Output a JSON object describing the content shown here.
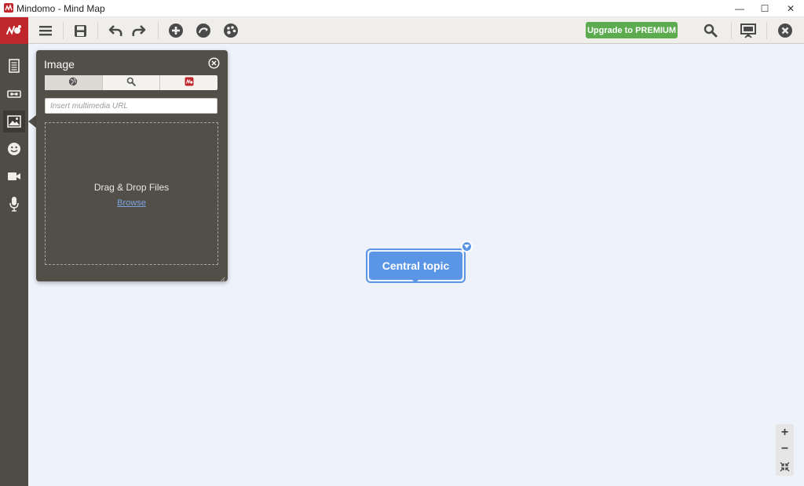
{
  "window": {
    "title": "Mindomo - Mind Map",
    "minimize_glyph": "—",
    "maximize_glyph": "☐",
    "close_glyph": "✕"
  },
  "toolbar": {
    "premium_label": "Upgrade to PREMIUM",
    "icons": [
      "menu-icon",
      "save-icon",
      "undo-icon",
      "redo-icon",
      "add-topic-icon",
      "connector-icon",
      "theme-icon",
      "search-icon",
      "presentation-icon",
      "close-icon"
    ]
  },
  "sidebar": {
    "items": [
      "notes-icon",
      "link-icon",
      "image-icon",
      "emoji-icon",
      "video-icon",
      "microphone-icon"
    ],
    "active": "image-icon"
  },
  "image_panel": {
    "title": "Image",
    "tabs": [
      "web-icon",
      "search-icon",
      "mindomo-icon"
    ],
    "active_tab": "web-icon",
    "url_placeholder": "Insert multimedia URL",
    "drop_text": "Drag & Drop Files",
    "browse_label": "Browse"
  },
  "map": {
    "central_topic": "Central topic"
  },
  "zoom": {
    "in_label": "+",
    "out_label": "−"
  },
  "colors": {
    "brand_red": "#c0272d",
    "sidebar_bg": "#4e4c45",
    "panel_bg": "#514f48",
    "topic_blue": "#5b95e6",
    "premium_green": "#5cab4e",
    "canvas_bg": "#eef3fb"
  }
}
